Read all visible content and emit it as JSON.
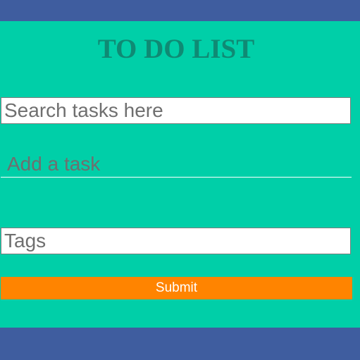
{
  "app": {
    "title": "TO DO LIST"
  },
  "search": {
    "placeholder": "Search tasks here",
    "value": ""
  },
  "add_task": {
    "placeholder": "Add a task",
    "value": ""
  },
  "tags": {
    "placeholder": "Tags",
    "value": ""
  },
  "submit": {
    "label": "Submit"
  },
  "colors": {
    "band": "#3f5d9f",
    "panel": "#00cfa8",
    "title": "#0f8a74",
    "submit_bg": "#ff8400",
    "submit_text": "#ffffff"
  }
}
